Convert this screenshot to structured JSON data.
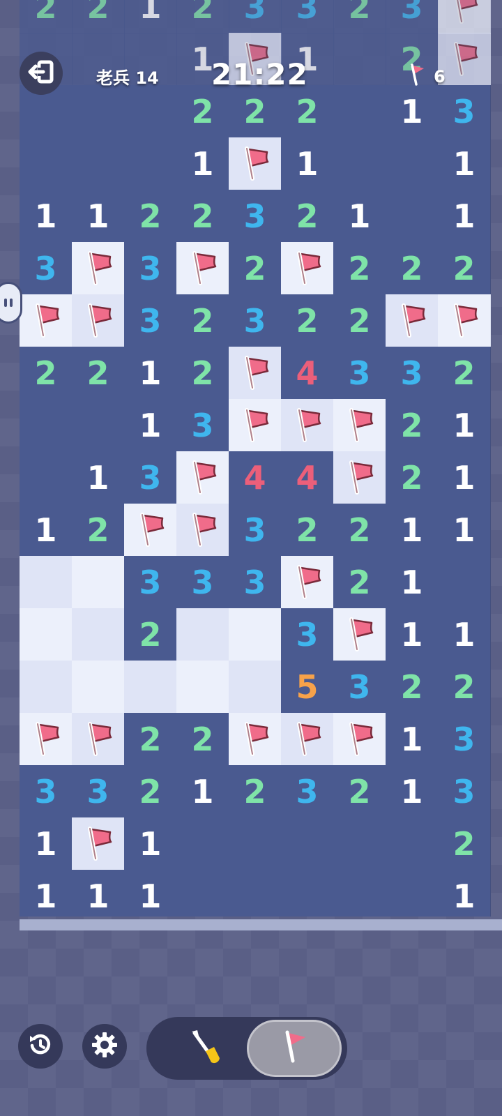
{
  "header": {
    "level_label": "老兵 14",
    "timer": "21:22",
    "flags_remaining": "6",
    "exit_icon": "exit-icon",
    "flag_icon": "flag-icon"
  },
  "colors": {
    "closed_cell": "#4a5a90",
    "open_cell": "#ecf0fb",
    "n1": "#ffffff",
    "n2": "#7fe3a8",
    "n3": "#3fb6ee",
    "n4": "#ec5f7a",
    "n5": "#f7a24a",
    "flag": "#f06c8a"
  },
  "board": {
    "rows": [
      [
        "2",
        "2",
        "1",
        "2",
        "3",
        "3",
        "2",
        "3",
        "F"
      ],
      [
        "",
        "",
        "",
        "1",
        "F",
        "1",
        "",
        "2",
        "F"
      ],
      [
        "",
        "",
        "",
        "2",
        "2",
        "2",
        "",
        "1",
        "3"
      ],
      [
        "",
        "",
        "",
        "1",
        "F",
        "1",
        "",
        "",
        "1"
      ],
      [
        "1",
        "1",
        "2",
        "2",
        "3",
        "2",
        "1",
        "",
        "1"
      ],
      [
        "3",
        "F",
        "3",
        "F",
        "2",
        "F",
        "2",
        "2",
        "2"
      ],
      [
        "F",
        "F",
        "3",
        "2",
        "3",
        "2",
        "2",
        "F",
        "F"
      ],
      [
        "2",
        "2",
        "1",
        "2",
        "F",
        "4",
        "3",
        "3",
        "2"
      ],
      [
        "",
        "",
        "1",
        "3",
        "F",
        "F",
        "F",
        "2",
        "1"
      ],
      [
        "",
        "1",
        "3",
        "F",
        "4",
        "4",
        "F",
        "2",
        "1"
      ],
      [
        "1",
        "2",
        "F",
        "F",
        "3",
        "2",
        "2",
        "1",
        "1"
      ],
      [
        "O",
        "O",
        "3",
        "3",
        "3",
        "F",
        "2",
        "1",
        ""
      ],
      [
        "O",
        "O",
        "2",
        "O",
        "O",
        "3",
        "F",
        "1",
        "1"
      ],
      [
        "O",
        "O",
        "O",
        "O",
        "O",
        "5",
        "3",
        "2",
        "2"
      ],
      [
        "F",
        "F",
        "2",
        "2",
        "F",
        "F",
        "F",
        "1",
        "3"
      ],
      [
        "3",
        "3",
        "2",
        "1",
        "2",
        "3",
        "2",
        "1",
        "3"
      ],
      [
        "1",
        "F",
        "1",
        "",
        "",
        "",
        "",
        "",
        "2"
      ],
      [
        "1",
        "1",
        "1",
        "",
        "",
        "",
        "",
        "",
        "1"
      ]
    ]
  },
  "controls": {
    "restart_icon": "restart-icon",
    "settings_icon": "gear-icon",
    "dig_icon": "shovel-icon",
    "flag_mode_icon": "flag-icon",
    "active_mode": "flag"
  }
}
